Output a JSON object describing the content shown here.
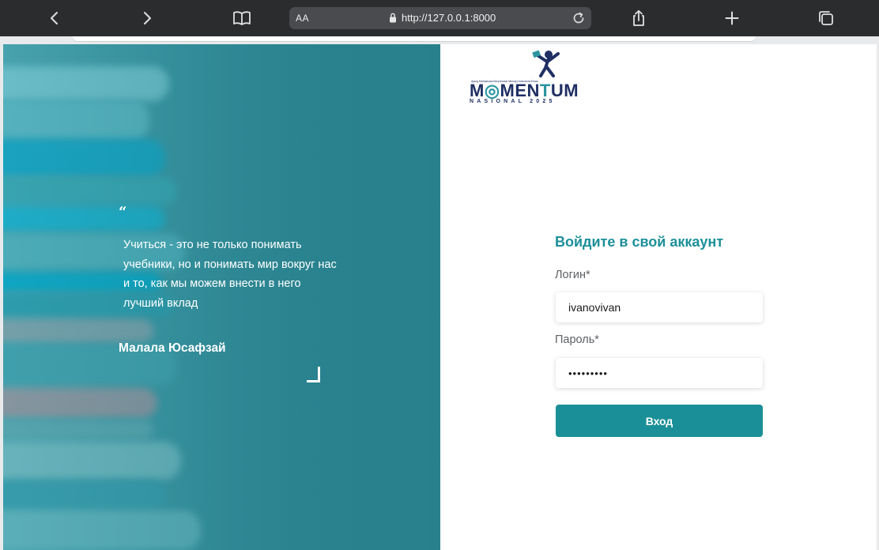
{
  "browser": {
    "address_prefix": "AA",
    "url": "http://127.0.0.1:8000"
  },
  "hero": {
    "quote_mark": "“",
    "quote": "Учиться - это не только понимать учебники, но и понимать мир вокруг нас и то, как мы можем внести в него лучший вклад",
    "author": "Малала Юсафзай"
  },
  "logo": {
    "name_part1": "M",
    "name_part2": "MEN",
    "name_t": "T",
    "name_part3": "UM",
    "subtitle": "NASIONAL 2025",
    "tagline": "Ajang Mahasiswa Berprestasi Menuju Indonesia Emas"
  },
  "form": {
    "title": "Войдите в свой аккаунт",
    "login_label": "Логин*",
    "login_value": "ivanovivan",
    "password_label": "Пароль*",
    "password_value": "•••••••••",
    "submit_label": "Вход"
  },
  "colors": {
    "accent": "#1a8f97",
    "title": "#1c8f99",
    "toolbar": "#2b2c2e",
    "logo_navy": "#1f2f63"
  }
}
